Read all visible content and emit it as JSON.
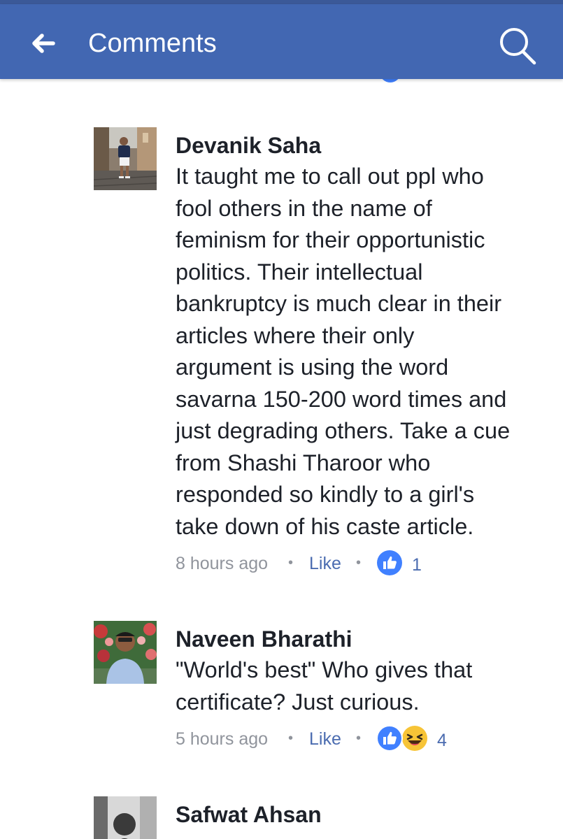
{
  "appbar": {
    "title": "Comments",
    "back_icon": "back-arrow-icon",
    "search_icon": "search-icon",
    "background": "#4267b2"
  },
  "comments": [
    {
      "author": "Devanik Saha",
      "lines": [
        "It taught me to call out ppl who",
        "fool others in the name of",
        "feminism for their opportunistic",
        "politics. Their intellectual",
        "bankruptcy is much clear in their",
        "articles where their only",
        "argument is using the word",
        "savarna 150-200 word times and",
        "just degrading others. Take a cue",
        "from Shashi Tharoor who",
        "responded so kindly to a girl's",
        "take down of his caste article."
      ],
      "time": "8 hours ago",
      "like_label": "Like",
      "separator": "•",
      "reactions": [
        "like"
      ],
      "reaction_count": "1"
    },
    {
      "author": "Naveen Bharathi",
      "lines": [
        "\"World's best\" Who gives that",
        "certificate? Just curious."
      ],
      "time": "5 hours ago",
      "like_label": "Like",
      "separator": "•",
      "reactions": [
        "like",
        "haha"
      ],
      "reaction_count": "4"
    },
    {
      "author": "Safwat Ahsan"
    }
  ],
  "colors": {
    "link": "#4b6cb0",
    "meta": "#90949c",
    "text": "#1d2129",
    "like_reaction": "#4080ff",
    "haha_reaction": "#f7c437"
  }
}
